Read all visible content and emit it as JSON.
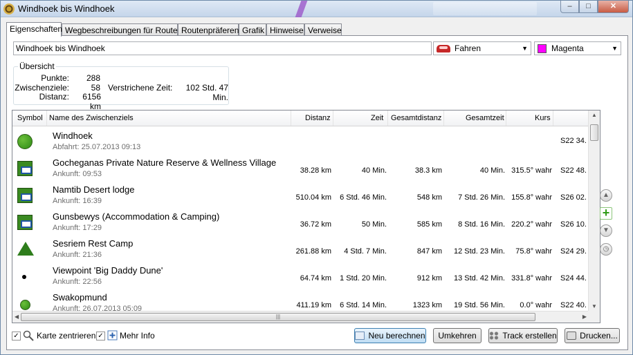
{
  "window": {
    "title": "Windhoek bis Windhoek",
    "min": "–",
    "max": "□",
    "close": "✕"
  },
  "tabs": [
    "Eigenschaften",
    "Wegbeschreibungen für Routen",
    "Routenpräferenz",
    "Grafik",
    "Hinweise",
    "Verweise"
  ],
  "route_name": "Windhoek bis Windhoek",
  "mode": "Fahren",
  "color": {
    "name": "Magenta",
    "hex": "#ff00ff"
  },
  "summary": {
    "legend": "Übersicht",
    "punkte_label": "Punkte:",
    "punkte": "288",
    "zwischenziele_label": "Zwischenziele:",
    "zwischenziele": "58",
    "distanz_label": "Distanz:",
    "distanz": "6156 km",
    "zeit_label": "Verstrichene Zeit:",
    "zeit": "102 Std. 47 Min."
  },
  "columns": [
    "Symbol",
    "Name des Zwischenziels",
    "Distanz",
    "Zeit",
    "Gesamtdistanz",
    "Gesamtzeit",
    "Kurs",
    ""
  ],
  "rows": [
    {
      "symbol": "green-circle-icon",
      "name": "Windhoek",
      "sub": "Abfahrt: 25.07.2013 09:13",
      "distanz": "",
      "zeit": "",
      "gesamtdistanz": "",
      "gesamtzeit": "",
      "kurs": "",
      "pos": "S22 34."
    },
    {
      "symbol": "lodge-icon",
      "name": "Gocheganas Private Nature Reserve & Wellness Village",
      "sub": "Ankunft: 09:53",
      "distanz": "38.28 km",
      "zeit": "40 Min.",
      "gesamtdistanz": "38.3 km",
      "gesamtzeit": "40 Min.",
      "kurs": "315.5° wahr",
      "pos": "S22 48."
    },
    {
      "symbol": "lodge-icon",
      "name": "Namtib Desert lodge",
      "sub": "Ankunft: 16:39",
      "distanz": "510.04 km",
      "zeit": "6 Std. 46 Min.",
      "gesamtdistanz": "548 km",
      "gesamtzeit": "7 Std. 26 Min.",
      "kurs": "155.8° wahr",
      "pos": "S26 02."
    },
    {
      "symbol": "lodge-icon",
      "name": "Gunsbewys (Accommodation & Camping)",
      "sub": "Ankunft: 17:29",
      "distanz": "36.72 km",
      "zeit": "50 Min.",
      "gesamtdistanz": "585 km",
      "gesamtzeit": "8 Std. 16 Min.",
      "kurs": "220.2° wahr",
      "pos": "S26 10."
    },
    {
      "symbol": "tent-icon",
      "name": "Sesriem Rest Camp",
      "sub": "Ankunft: 21:36",
      "distanz": "261.88 km",
      "zeit": "4 Std. 7 Min.",
      "gesamtdistanz": "847 km",
      "gesamtzeit": "12 Std. 23 Min.",
      "kurs": "75.8° wahr",
      "pos": "S24 29."
    },
    {
      "symbol": "dot-icon",
      "name": "Viewpoint 'Big Daddy Dune'",
      "sub": "Ankunft: 22:56",
      "distanz": "64.74 km",
      "zeit": "1 Std. 20 Min.",
      "gesamtdistanz": "912 km",
      "gesamtzeit": "13 Std. 42 Min.",
      "kurs": "331.8° wahr",
      "pos": "S24 44."
    },
    {
      "symbol": "small-green-circle-icon",
      "name": "Swakopmund",
      "sub": "Ankunft: 26.07.2013 05:09",
      "distanz": "411.19 km",
      "zeit": "6 Std. 14 Min.",
      "gesamtdistanz": "1323 km",
      "gesamtzeit": "19 Std. 56 Min.",
      "kurs": "0.0° wahr",
      "pos": "S22 40."
    }
  ],
  "side_buttons": [
    "arrow-up-icon",
    "add-icon",
    "arrow-down-icon",
    "clock-icon"
  ],
  "bottom": {
    "karte_zentrieren": "Karte zentrieren",
    "mehr_info": "Mehr Info",
    "neu_berechnen": "Neu berechnen",
    "umkehren": "Umkehren",
    "track_erstellen": "Track erstellen",
    "drucken": "Drucken..."
  }
}
